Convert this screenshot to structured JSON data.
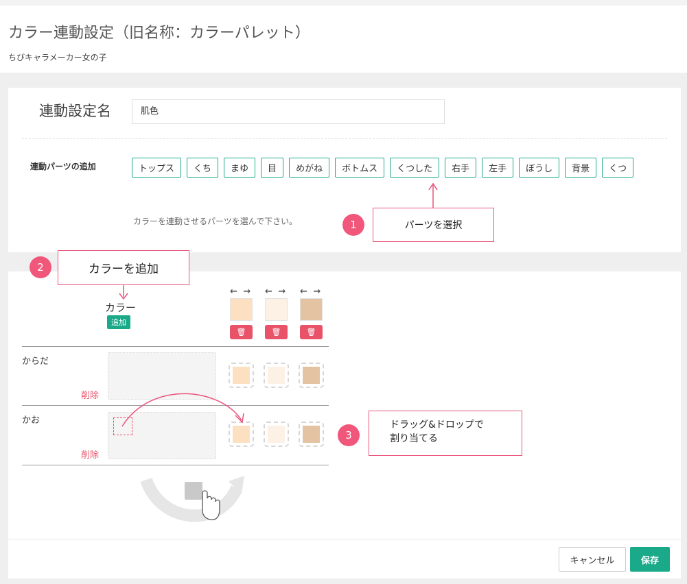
{
  "header": {
    "title": "カラー連動設定（旧名称：カラーパレット）",
    "subtitle": "ちびキャラメーカー女の子"
  },
  "form": {
    "name_label": "連動設定名",
    "name_value": "肌色",
    "parts_label": "連動パーツの追加",
    "parts": [
      "トップス",
      "くち",
      "まゆ",
      "目",
      "めがね",
      "ボトムス",
      "くつした",
      "右手",
      "左手",
      "ぼうし",
      "背景",
      "くつ"
    ],
    "parts_help": "カラーを連動させるパーツを選んで下さい。"
  },
  "palette": {
    "header_label": "カラー",
    "add_label": "追加",
    "move_arrows": "← →",
    "delete_icon": "🗑",
    "colors": [
      "#fde0c2",
      "#fdf0e4",
      "#e3c3a2"
    ],
    "rows": [
      {
        "name": "からだ",
        "delete_label": "削除"
      },
      {
        "name": "かお",
        "delete_label": "削除"
      }
    ]
  },
  "callouts": {
    "c1": {
      "number": "1",
      "text": "パーツを選択"
    },
    "c2": {
      "number": "2",
      "text": "カラーを追加"
    },
    "c3": {
      "number": "3",
      "line1": "ドラッグ&ドロップで",
      "line2": "割り当てる"
    }
  },
  "footer": {
    "cancel_label": "キャンセル",
    "save_label": "保存"
  },
  "accent_color": "#1aaa8a",
  "danger_color": "#e9536a"
}
